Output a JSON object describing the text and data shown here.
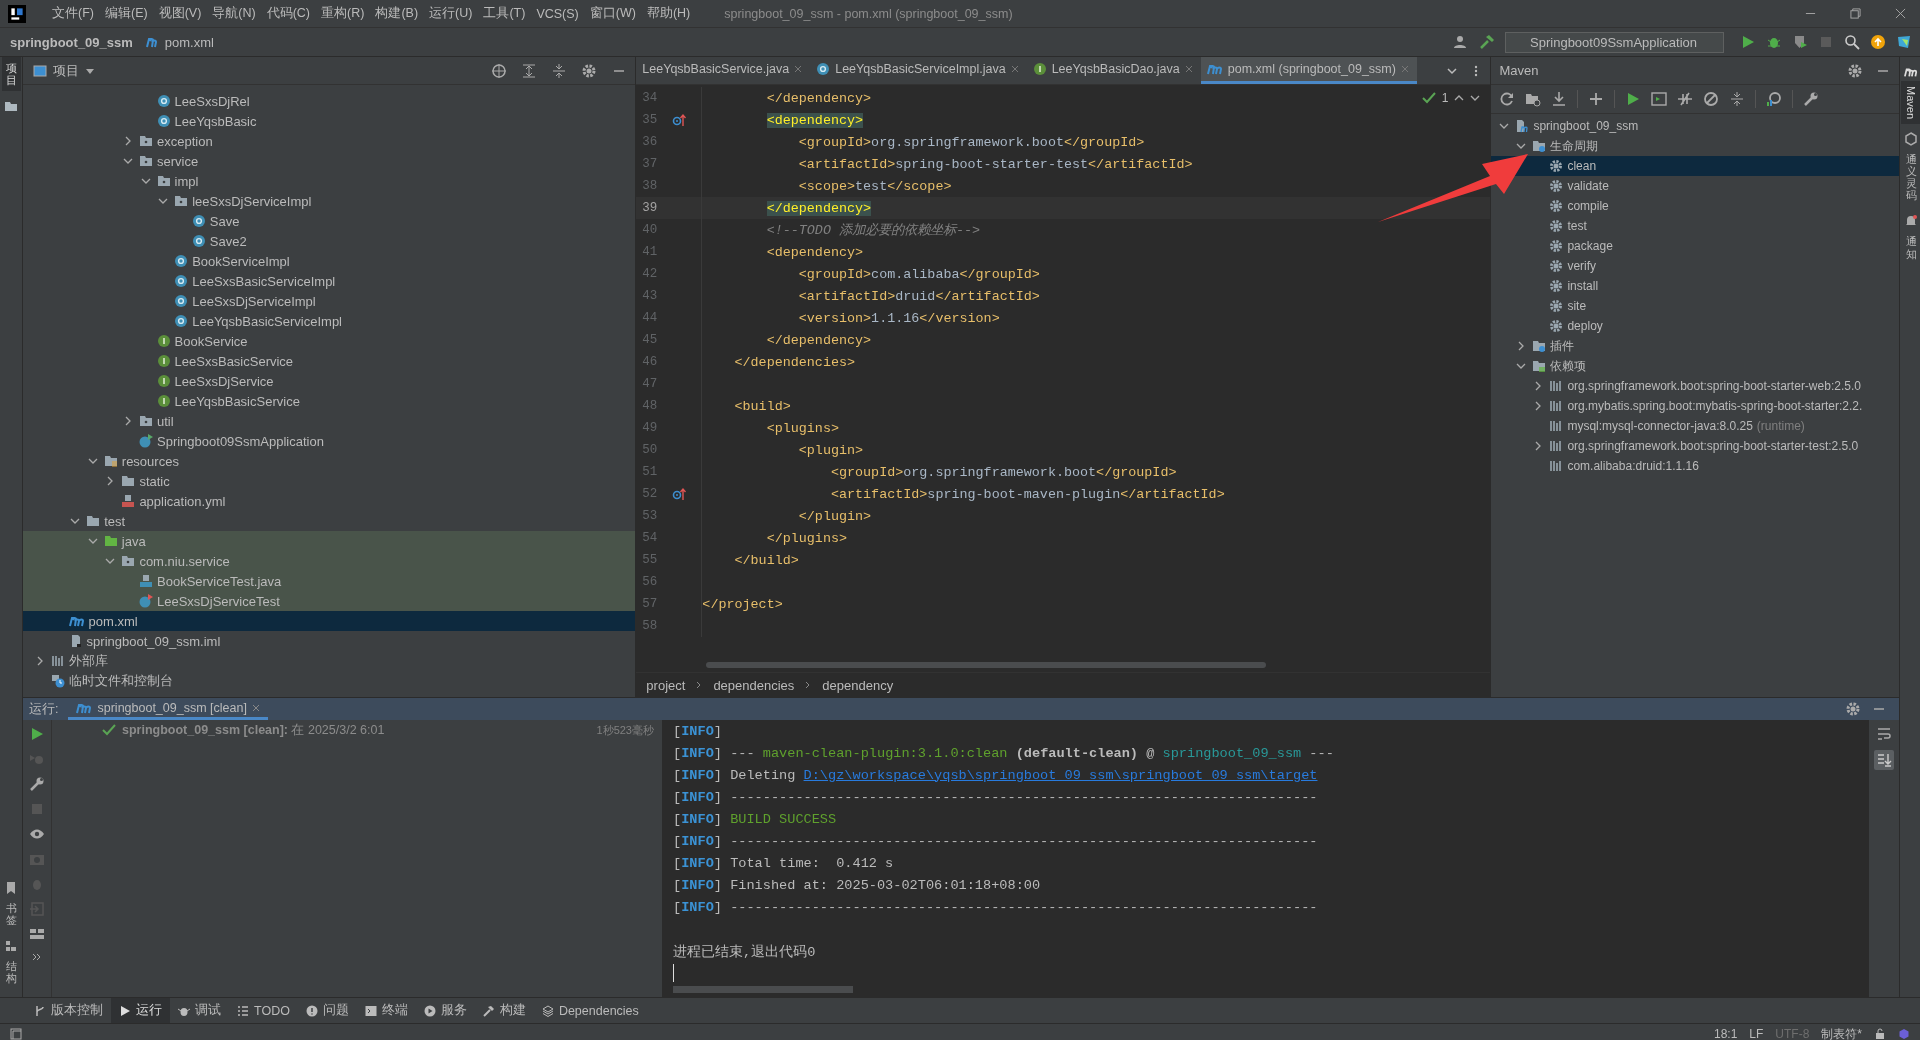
{
  "window": {
    "title": "springboot_09_ssm - pom.xml (springboot_09_ssm)"
  },
  "menu": [
    "文件(F)",
    "编辑(E)",
    "视图(V)",
    "导航(N)",
    "代码(C)",
    "重构(R)",
    "构建(B)",
    "运行(U)",
    "工具(T)",
    "VCS(S)",
    "窗口(W)",
    "帮助(H)"
  ],
  "breadcrumb": [
    "springboot_09_ssm",
    "pom.xml"
  ],
  "run_config": "Springboot09SsmApplication",
  "left_stripe": [
    {
      "label": "项目",
      "selected": true
    }
  ],
  "left_stripe_bottom": [
    {
      "label": "书签",
      "selected": false
    },
    {
      "label": "结构",
      "selected": false
    }
  ],
  "right_stripe": [
    {
      "kind": "maven",
      "label": "Maven",
      "selected": true
    },
    {
      "kind": "assistant",
      "label": "通义灵码",
      "selected": false
    },
    {
      "kind": "bell",
      "label": "通知",
      "selected": false
    }
  ],
  "project": {
    "title": "项目",
    "tree": [
      {
        "children": [
          {
            "children": [
              {
                "children": [
                  {
                    "children": [
                      {
                        "children": [
                          {
                            "children": [
                              {
                                "label": "LeeSxsDjRel",
                                "kind": "class",
                                "selected": false
                              },
                              {
                                "label": "LeeYqsbBasic",
                                "kind": "class",
                                "selected": false
                              }
                            ]
                          },
                          {
                            "label": "exception",
                            "kind": "package",
                            "expanded": false,
                            "selected": false
                          },
                          {
                            "label": "service",
                            "kind": "package",
                            "expanded": true,
                            "selected": false,
                            "children": [
                              {
                                "label": "impl",
                                "kind": "package",
                                "expanded": true,
                                "selected": false,
                                "children": [
                                  {
                                    "label": "leeSxsDjServiceImpl",
                                    "kind": "package",
                                    "expanded": true,
                                    "selected": false,
                                    "children": [
                                      {
                                        "label": "Save",
                                        "kind": "class",
                                        "selected": false
                                      },
                                      {
                                        "label": "Save2",
                                        "kind": "class",
                                        "selected": false
                                      }
                                    ]
                                  },
                                  {
                                    "label": "BookServiceImpl",
                                    "kind": "class",
                                    "selected": false
                                  },
                                  {
                                    "label": "LeeSxsBasicServiceImpl",
                                    "kind": "class",
                                    "selected": false
                                  },
                                  {
                                    "label": "LeeSxsDjServiceImpl",
                                    "kind": "class",
                                    "selected": false
                                  },
                                  {
                                    "label": "LeeYqsbBasicServiceImpl",
                                    "kind": "class",
                                    "selected": false
                                  }
                                ]
                              },
                              {
                                "label": "BookService",
                                "kind": "interface",
                                "selected": false
                              },
                              {
                                "label": "LeeSxsBasicService",
                                "kind": "interface",
                                "selected": false
                              },
                              {
                                "label": "LeeSxsDjService",
                                "kind": "interface",
                                "selected": false
                              },
                              {
                                "label": "LeeYqsbBasicService",
                                "kind": "interface",
                                "selected": false
                              }
                            ]
                          },
                          {
                            "label": "util",
                            "kind": "package",
                            "expanded": false,
                            "selected": false
                          },
                          {
                            "label": "Springboot09SsmApplication",
                            "kind": "app",
                            "selected": false
                          }
                        ]
                      }
                    ]
                  },
                  {
                    "label": "resources",
                    "kind": "resources",
                    "expanded": true,
                    "selected": false,
                    "children": [
                      {
                        "label": "static",
                        "kind": "folder",
                        "expanded": false,
                        "selected": false
                      },
                      {
                        "label": "application.yml",
                        "kind": "yml",
                        "selected": false
                      }
                    ]
                  }
                ]
              },
              {
                "label": "test",
                "kind": "folder",
                "expanded": true,
                "selected": false,
                "children": [
                  {
                    "label": "java",
                    "kind": "test-folder",
                    "expanded": true,
                    "selected": false,
                    "test_scope": true,
                    "children": [
                      {
                        "label": "com.niu.service",
                        "kind": "package",
                        "expanded": true,
                        "selected": false,
                        "children": [
                          {
                            "label": "BookServiceTest.java",
                            "kind": "java-file",
                            "selected": false
                          },
                          {
                            "label": "LeeSxsDjServiceTest",
                            "kind": "test-class",
                            "selected": false
                          }
                        ]
                      }
                    ]
                  }
                ]
              }
            ]
          },
          {
            "label": "pom.xml",
            "kind": "maven",
            "selected": true
          },
          {
            "label": "springboot_09_ssm.iml",
            "kind": "iml",
            "selected": false
          }
        ]
      },
      {
        "label": "外部库",
        "kind": "library",
        "expanded": false,
        "selected": false
      },
      {
        "label": "临时文件和控制台",
        "kind": "scratch",
        "selected": false
      }
    ]
  },
  "editor": {
    "tabs": [
      {
        "label": "LeeYqsbBasicService.java",
        "kind": "none",
        "selected": false
      },
      {
        "label": "LeeYqsbBasicServiceImpl.java",
        "kind": "class",
        "selected": false
      },
      {
        "label": "LeeYqsbBasicDao.java",
        "kind": "interface",
        "selected": false
      },
      {
        "label": "pom.xml (springboot_09_ssm)",
        "kind": "maven",
        "selected": true
      }
    ],
    "problems": "1",
    "lines": [
      {
        "n": "34",
        "text": "        </dependency>"
      },
      {
        "n": "35",
        "text": "        <dependency>",
        "match": true,
        "marker": true
      },
      {
        "n": "36",
        "text": "            <groupId>org.springframework.boot</groupId>"
      },
      {
        "n": "37",
        "text": "            <artifactId>spring-boot-starter-test</artifactId>"
      },
      {
        "n": "38",
        "text": "            <scope>test</scope>"
      },
      {
        "n": "39",
        "text": "        </dependency>",
        "match": true,
        "current": true
      },
      {
        "n": "40",
        "text": "        <!--TODO 添加必要的依赖坐标-->",
        "kind": "comment"
      },
      {
        "n": "41",
        "text": "        <dependency>"
      },
      {
        "n": "42",
        "text": "            <groupId>com.alibaba</groupId>"
      },
      {
        "n": "43",
        "text": "            <artifactId>druid</artifactId>"
      },
      {
        "n": "44",
        "text": "            <version>1.1.16</version>"
      },
      {
        "n": "45",
        "text": "        </dependency>"
      },
      {
        "n": "46",
        "text": "    </dependencies>"
      },
      {
        "n": "47"
      },
      {
        "n": "48",
        "text": "    <build>"
      },
      {
        "n": "49",
        "text": "        <plugins>"
      },
      {
        "n": "50",
        "text": "            <plugin>"
      },
      {
        "n": "51",
        "text": "                <groupId>org.springframework.boot</groupId>"
      },
      {
        "n": "52",
        "text": "                <artifactId>spring-boot-maven-plugin</artifactId>",
        "marker": true
      },
      {
        "n": "53",
        "text": "            </plugin>"
      },
      {
        "n": "54",
        "text": "        </plugins>"
      },
      {
        "n": "55",
        "text": "    </build>"
      },
      {
        "n": "56"
      },
      {
        "n": "57",
        "text": "</project>"
      },
      {
        "n": "58"
      }
    ],
    "path": [
      "project",
      "dependencies",
      "dependency"
    ]
  },
  "maven": {
    "title": "Maven",
    "tree": [
      {
        "label": "springboot_09_ssm",
        "kind": "maven-project",
        "expanded": true,
        "selected": false,
        "children": [
          {
            "label": "生命周期",
            "kind": "lifecycle",
            "expanded": true,
            "selected": false,
            "children": [
              {
                "label": "clean",
                "kind": "goal",
                "selected": true
              },
              {
                "label": "validate",
                "kind": "goal",
                "selected": false
              },
              {
                "label": "compile",
                "kind": "goal",
                "selected": false
              },
              {
                "label": "test",
                "kind": "goal",
                "selected": false
              },
              {
                "label": "package",
                "kind": "goal",
                "selected": false
              },
              {
                "label": "verify",
                "kind": "goal",
                "selected": false
              },
              {
                "label": "install",
                "kind": "goal",
                "selected": false
              },
              {
                "label": "site",
                "kind": "goal",
                "selected": false
              },
              {
                "label": "deploy",
                "kind": "goal",
                "selected": false
              }
            ]
          },
          {
            "label": "插件",
            "kind": "lifecycle",
            "expanded": false,
            "selected": false
          },
          {
            "label": "依赖项",
            "kind": "deps",
            "expanded": true,
            "selected": false,
            "children": [
              {
                "label": "org.springframework.boot:spring-boot-starter-web:2.5.0",
                "kind": "library",
                "expanded": false,
                "selected": false
              },
              {
                "label": "org.mybatis.spring.boot:mybatis-spring-boot-starter:2.2.",
                "kind": "library",
                "expanded": false,
                "selected": false
              },
              {
                "label": "mysql:mysql-connector-java:8.0.25",
                "note": "(runtime)",
                "kind": "library",
                "selected": false
              },
              {
                "label": "org.springframework.boot:spring-boot-starter-test:2.5.0",
                "kind": "library",
                "expanded": false,
                "selected": false
              },
              {
                "label": "com.alibaba:druid:1.1.16",
                "kind": "library",
                "selected": false
              }
            ]
          }
        ]
      }
    ]
  },
  "run": {
    "label": "运行:",
    "tabs": [
      {
        "label": "springboot_09_ssm [clean]",
        "selected": true
      }
    ],
    "result": {
      "kind": "success",
      "text": "**springboot_09_ssm [clean]:** 在 2025/3/2 6:01",
      "duration": "1秒523毫秒"
    },
    "console": [
      {
        "segments": [
          {
            "kind": "plain",
            "text": "["
          },
          {
            "kind": "info",
            "text": "INFO"
          },
          {
            "kind": "plain",
            "text": "]"
          }
        ]
      },
      {
        "segments": [
          {
            "kind": "plain",
            "text": "["
          },
          {
            "kind": "info",
            "text": "INFO"
          },
          {
            "kind": "plain",
            "text": "] --- "
          },
          {
            "kind": "green",
            "text": "maven-clean-plugin:3.1.0:clean"
          },
          {
            "kind": "bold",
            "text": " (default-clean)"
          },
          {
            "kind": "plain",
            "text": " @ "
          },
          {
            "kind": "teal",
            "text": "springboot_09_ssm"
          },
          {
            "kind": "plain",
            "text": " ---"
          }
        ]
      },
      {
        "segments": [
          {
            "kind": "plain",
            "text": "["
          },
          {
            "kind": "info",
            "text": "INFO"
          },
          {
            "kind": "plain",
            "text": "] Deleting "
          },
          {
            "kind": "link",
            "text": "D:\\gz\\workspace\\yqsb\\springboot_09_ssm\\springboot_09_ssm\\target"
          }
        ]
      },
      {
        "segments": [
          {
            "kind": "plain",
            "text": "["
          },
          {
            "kind": "info",
            "text": "INFO"
          },
          {
            "kind": "plain",
            "text": "] ------------------------------------------------------------------------"
          }
        ]
      },
      {
        "segments": [
          {
            "kind": "plain",
            "text": "["
          },
          {
            "kind": "info",
            "text": "INFO"
          },
          {
            "kind": "plain",
            "text": "] "
          },
          {
            "kind": "green",
            "text": "BUILD SUCCESS"
          }
        ]
      },
      {
        "segments": [
          {
            "kind": "plain",
            "text": "["
          },
          {
            "kind": "info",
            "text": "INFO"
          },
          {
            "kind": "plain",
            "text": "] ------------------------------------------------------------------------"
          }
        ]
      },
      {
        "segments": [
          {
            "kind": "plain",
            "text": "["
          },
          {
            "kind": "info",
            "text": "INFO"
          },
          {
            "kind": "plain",
            "text": "] Total time:  0.412 s"
          }
        ]
      },
      {
        "segments": [
          {
            "kind": "plain",
            "text": "["
          },
          {
            "kind": "info",
            "text": "INFO"
          },
          {
            "kind": "plain",
            "text": "] Finished at: 2025-03-02T06:01:18+08:00"
          }
        ]
      },
      {
        "segments": [
          {
            "kind": "plain",
            "text": "["
          },
          {
            "kind": "info",
            "text": "INFO"
          },
          {
            "kind": "plain",
            "text": "] ------------------------------------------------------------------------"
          }
        ]
      },
      {
        "segments": [
          {
            "kind": "plain",
            "text": "进程已结束,退出代码0"
          }
        ],
        "gap_before": true
      }
    ]
  },
  "tool_tabs": [
    {
      "label": "版本控制",
      "kind": "branch",
      "selected": false
    },
    {
      "label": "运行",
      "kind": "play",
      "selected": true
    },
    {
      "label": "调试",
      "kind": "bug",
      "selected": false
    },
    {
      "label": "TODO",
      "kind": "list",
      "selected": false
    },
    {
      "label": "问题",
      "kind": "alert",
      "selected": false
    },
    {
      "label": "终端",
      "kind": "terminal",
      "selected": false
    },
    {
      "label": "服务",
      "kind": "service",
      "selected": false
    },
    {
      "label": "构建",
      "kind": "hammer",
      "selected": false
    },
    {
      "label": "Dependencies",
      "kind": "layers",
      "selected": false
    }
  ],
  "status_bar": [
    "18:1",
    "LF",
    "UTF-8",
    "制表符*"
  ]
}
